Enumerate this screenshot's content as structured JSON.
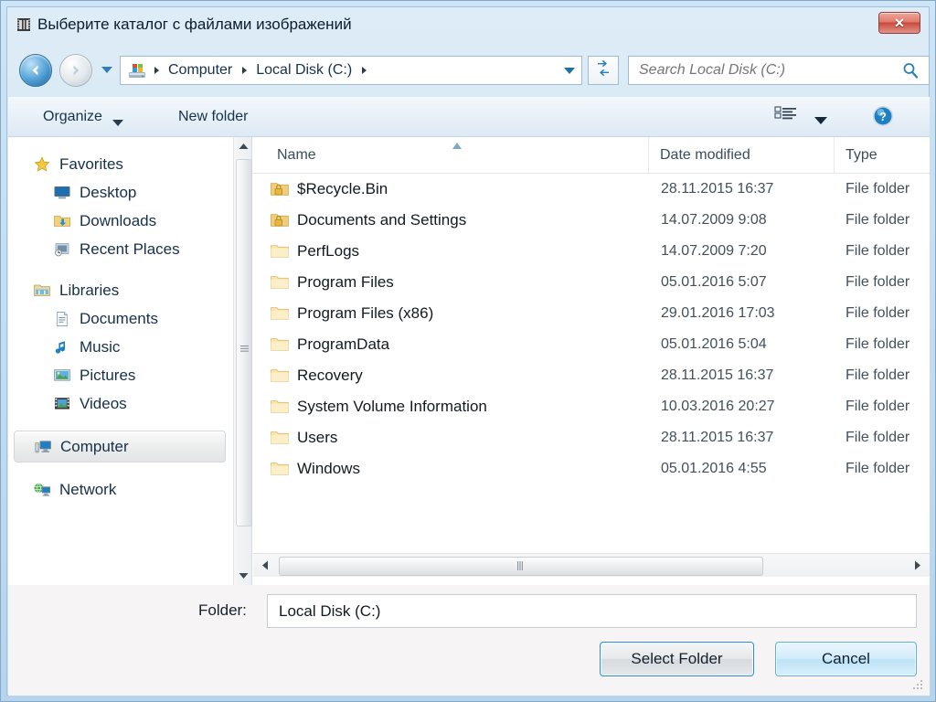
{
  "window": {
    "title": "Выберите каталог с файлами изображений",
    "title_icon": "film-strip-icon",
    "close_label": "✕"
  },
  "navigation": {
    "back_icon": "back-arrow-icon",
    "forward_icon": "forward-arrow-icon",
    "history_icon": "chevron-down-icon",
    "refresh_icon": "refresh-icon",
    "address_icon": "computer-drive-icon",
    "dropdown_icon": "chevron-down-icon",
    "breadcrumbs": [
      "Computer",
      "Local Disk (C:)"
    ],
    "separator": "▸"
  },
  "search": {
    "placeholder": "Search Local Disk (C:)",
    "value": "",
    "icon": "search-icon"
  },
  "toolbar": {
    "organize_label": "Organize",
    "organize_caret": "caret-down-icon",
    "new_folder_label": "New folder",
    "view_icon": "details-view-icon",
    "view_caret": "caret-down-icon",
    "help_icon": "help-icon"
  },
  "sidebar": {
    "groups": [
      {
        "header": {
          "label": "Favorites",
          "icon": "star-icon"
        },
        "items": [
          {
            "label": "Desktop",
            "icon": "desktop-icon"
          },
          {
            "label": "Downloads",
            "icon": "downloads-folder-icon"
          },
          {
            "label": "Recent Places",
            "icon": "recent-places-icon"
          }
        ]
      },
      {
        "header": {
          "label": "Libraries",
          "icon": "libraries-icon"
        },
        "items": [
          {
            "label": "Documents",
            "icon": "document-icon"
          },
          {
            "label": "Music",
            "icon": "music-note-icon"
          },
          {
            "label": "Pictures",
            "icon": "pictures-icon"
          },
          {
            "label": "Videos",
            "icon": "video-icon"
          }
        ]
      },
      {
        "header": {
          "label": "Computer",
          "icon": "computer-icon",
          "selected": true
        },
        "items": []
      },
      {
        "header": {
          "label": "Network",
          "icon": "network-icon"
        },
        "items": []
      }
    ],
    "scrollbar": {
      "up_icon": "scroll-up-icon",
      "down_icon": "scroll-down-icon",
      "grip_icon": "grip-icon"
    }
  },
  "filelist": {
    "columns": [
      "Name",
      "Date modified",
      "Type"
    ],
    "sort_column": "Name",
    "sort_indicator": "sort-ascending-icon",
    "rows": [
      {
        "name": "$Recycle.Bin",
        "date": "28.11.2015 16:37",
        "type": "File folder",
        "icon": "locked-folder-icon"
      },
      {
        "name": "Documents and Settings",
        "date": "14.07.2009 9:08",
        "type": "File folder",
        "icon": "locked-folder-icon"
      },
      {
        "name": "PerfLogs",
        "date": "14.07.2009 7:20",
        "type": "File folder",
        "icon": "folder-icon"
      },
      {
        "name": "Program Files",
        "date": "05.01.2016 5:07",
        "type": "File folder",
        "icon": "folder-icon"
      },
      {
        "name": "Program Files (x86)",
        "date": "29.01.2016 17:03",
        "type": "File folder",
        "icon": "folder-icon"
      },
      {
        "name": "ProgramData",
        "date": "05.01.2016 5:04",
        "type": "File folder",
        "icon": "folder-icon"
      },
      {
        "name": "Recovery",
        "date": "28.11.2015 16:37",
        "type": "File folder",
        "icon": "folder-icon"
      },
      {
        "name": "System Volume Information",
        "date": "10.03.2016 20:27",
        "type": "File folder",
        "icon": "folder-icon"
      },
      {
        "name": "Users",
        "date": "28.11.2015 16:37",
        "type": "File folder",
        "icon": "folder-icon"
      },
      {
        "name": "Windows",
        "date": "05.01.2016 4:55",
        "type": "File folder",
        "icon": "folder-icon"
      }
    ],
    "hscrollbar": {
      "left_icon": "scroll-left-icon",
      "right_icon": "scroll-right-icon",
      "grip_icon": "grip-icon"
    }
  },
  "footer": {
    "folder_label": "Folder:",
    "folder_value": "Local Disk (C:)",
    "select_label": "Select Folder",
    "cancel_label": "Cancel",
    "resize_grip": "resize-grip-icon"
  },
  "colors": {
    "accent": "#2a8fd0",
    "close": "#c94b3c",
    "folder": "#f3d07a",
    "text": "#13202c"
  }
}
